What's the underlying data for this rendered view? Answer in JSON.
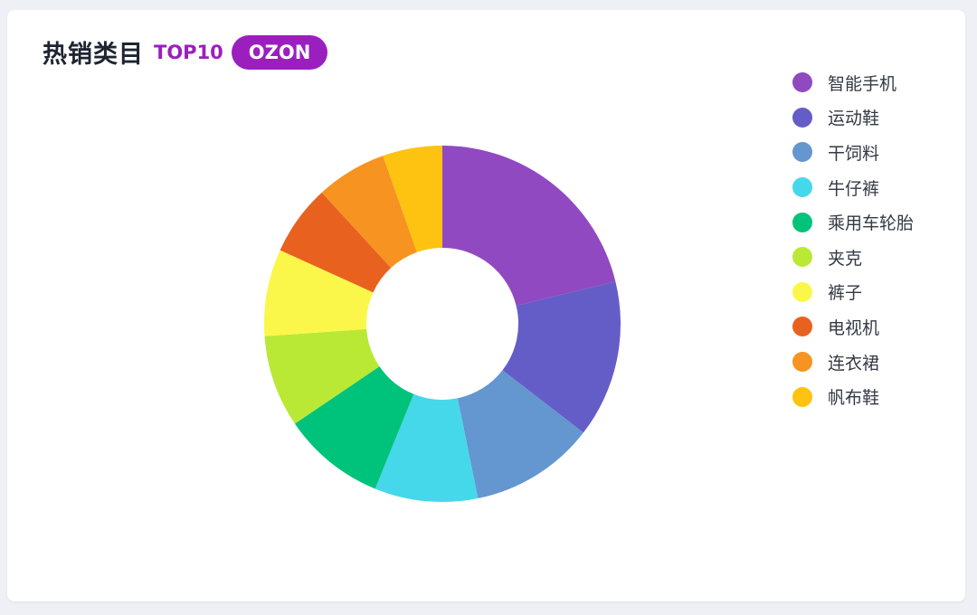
{
  "header": {
    "title": "热销类目",
    "subtitle": "TOP10",
    "platform_badge": "OZON"
  },
  "colors": {
    "accent": "#9b1fbf"
  },
  "chart_data": {
    "type": "pie",
    "variant": "donut",
    "legend_position": "right",
    "categories": [
      "智能手机",
      "运动鞋",
      "干饲料",
      "牛仔裤",
      "乘用车轮胎",
      "夹克",
      "裤子",
      "电视机",
      "连衣裙",
      "帆布鞋"
    ],
    "values": [
      21.5,
      14.5,
      11.5,
      9.5,
      9.5,
      8.5,
      8,
      6.5,
      6.5,
      5.5
    ],
    "colors": [
      "#9149c2",
      "#655dc7",
      "#6496d0",
      "#44d8ea",
      "#00c37b",
      "#b9e934",
      "#fbf74a",
      "#e9611f",
      "#f79321",
      "#fdc310"
    ]
  }
}
